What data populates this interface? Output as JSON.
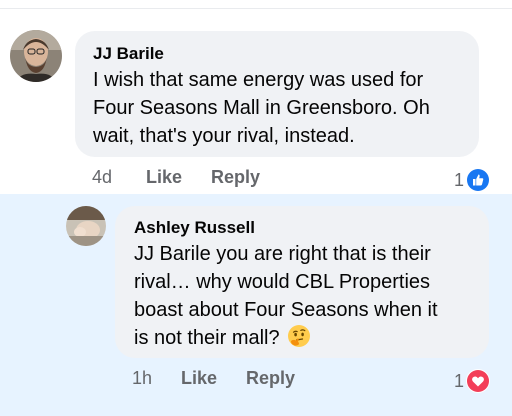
{
  "comments": [
    {
      "author": "JJ Barile",
      "lines": [
        "I wish that same energy was used for",
        "Four Seasons Mall in Greensboro. Oh",
        "wait, that's your rival, instead."
      ],
      "time": "4d",
      "like_label": "Like",
      "reply_label": "Reply",
      "reaction_count": "1",
      "reaction_icon": "thumbs-up-icon",
      "reaction_color": "#1877f2"
    },
    {
      "author": "Ashley Russell",
      "lines": [
        "JJ Barile you are right that is their",
        "rival… why would CBL Properties",
        "boast about Four Seasons when it",
        "is not their mall?"
      ],
      "emoji": "thinking-face-icon",
      "time": "1h",
      "like_label": "Like",
      "reply_label": "Reply",
      "reaction_count": "1",
      "reaction_icon": "heart-icon",
      "reaction_color": "#f33e58"
    }
  ],
  "colors": {
    "reply_highlight": "#e7f3ff",
    "bubble": "#f0f2f5",
    "meta_text": "#65676b"
  }
}
